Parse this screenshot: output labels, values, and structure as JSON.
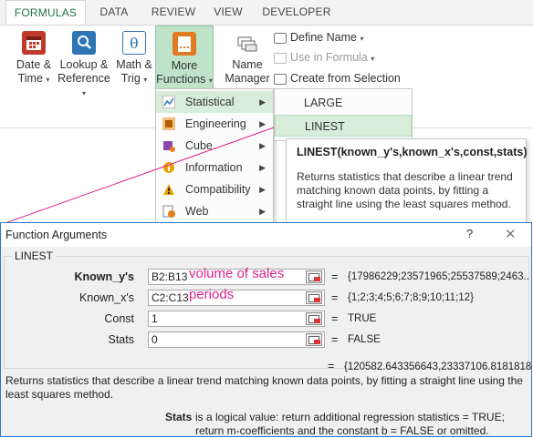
{
  "ribbon": {
    "tabs": [
      "FORMULAS",
      "DATA",
      "REVIEW",
      "VIEW",
      "DEVELOPER"
    ],
    "active_tab": "FORMULAS",
    "buttons": [
      {
        "line1": "Date &",
        "line2": "Time",
        "icon": "calendar-icon"
      },
      {
        "line1": "Lookup &",
        "line2": "Reference",
        "icon": "magnifier-icon"
      },
      {
        "line1": "Math &",
        "line2": "Trig",
        "icon": "theta-icon"
      },
      {
        "line1": "More",
        "line2": "Functions",
        "icon": "more-functions-icon"
      },
      {
        "line1": "Name",
        "line2": "Manager",
        "icon": "name-manager-icon"
      }
    ],
    "define_name": "Define Name",
    "use_in_formula": "Use in Formula",
    "create_from_selection": "Create from Selection"
  },
  "menu": {
    "items": [
      {
        "label": "Statistical",
        "icon": "statistical-icon",
        "highlighted": true
      },
      {
        "label": "Engineering",
        "icon": "engineering-icon",
        "highlighted": false
      },
      {
        "label": "Cube",
        "icon": "cube-icon",
        "highlighted": false
      },
      {
        "label": "Information",
        "icon": "information-icon",
        "highlighted": false
      },
      {
        "label": "Compatibility",
        "icon": "compatibility-icon",
        "highlighted": false
      },
      {
        "label": "Web",
        "icon": "web-icon",
        "highlighted": false
      }
    ]
  },
  "submenu": {
    "items": [
      {
        "label": "LARGE",
        "highlighted": false
      },
      {
        "label": "LINEST",
        "highlighted": true
      }
    ]
  },
  "tooltip": {
    "title": "LINEST(known_y's,known_x's,const,stats)",
    "body": "Returns statistics that describe a linear trend matching known data points, by fitting a straight line using the least squares method."
  },
  "dialog": {
    "title": "Function Arguments",
    "help": "?",
    "close": "✕",
    "function_name": "LINEST",
    "args": [
      {
        "label": "Known_y's",
        "bold": true,
        "value": "B2:B13",
        "note": "volume of sales",
        "result": "{17986229;23571965;25537589;2463..."
      },
      {
        "label": "Known_x's",
        "bold": false,
        "value": "C2:C13",
        "note": "periods",
        "result": "{1;2;3;4;5;6;7;8;9;10;11;12}"
      },
      {
        "label": "Const",
        "bold": false,
        "value": "1",
        "note": "",
        "result": "TRUE"
      },
      {
        "label": "Stats",
        "bold": false,
        "value": "0",
        "note": "",
        "result": "FALSE"
      }
    ],
    "equals": "=",
    "final_result": "{120582.643356643,23337106.8181818",
    "description": "Returns statistics that describe a linear trend matching known data points, by fitting a straight line using the least squares method.",
    "stats_name": "Stats",
    "stats_description": "is a logical value: return additional regression statistics = TRUE; return m-coefficients and the constant b = FALSE or omitted."
  },
  "colors": {
    "accent_green": "#217346",
    "selection_green": "#d7ecd9",
    "annotation_magenta": "#e0228c",
    "dialog_border": "#2b78c8"
  }
}
